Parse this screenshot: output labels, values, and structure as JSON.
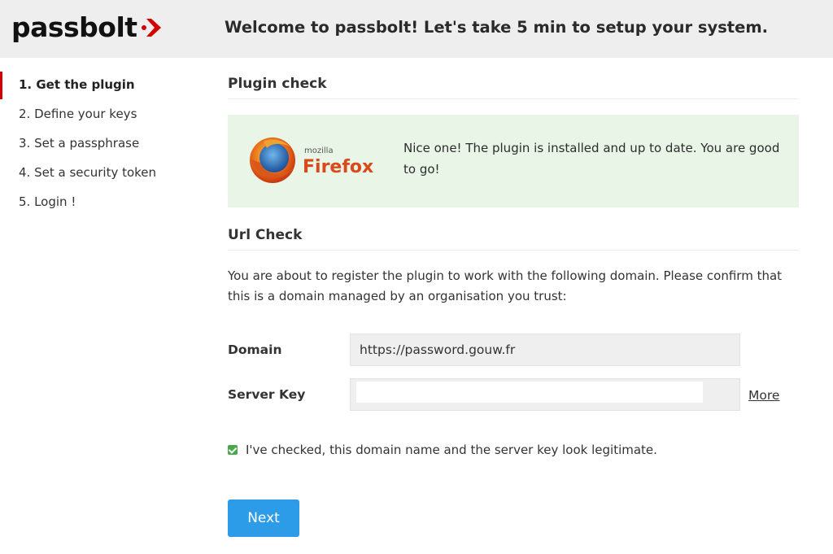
{
  "header": {
    "logo_text": "passbolt",
    "title": "Welcome to passbolt! Let's take 5 min to setup your system."
  },
  "sidebar": {
    "steps": [
      {
        "label": "1. Get the plugin",
        "active": true
      },
      {
        "label": "2. Define your keys",
        "active": false
      },
      {
        "label": "3. Set a passphrase",
        "active": false
      },
      {
        "label": "4. Set a security token",
        "active": false
      },
      {
        "label": "5. Login !",
        "active": false
      }
    ]
  },
  "plugin_check": {
    "title": "Plugin check",
    "browser_brand_small": "mozilla",
    "browser_brand": "Firefox",
    "message": "Nice one! The plugin is installed and up to date. You are good to go!"
  },
  "url_check": {
    "title": "Url Check",
    "intro": "You are about to register the plugin to work with the following domain. Please confirm that this is a domain managed by an organisation you trust:",
    "domain_label": "Domain",
    "domain_value": "https://password.gouw.fr",
    "server_key_label": "Server Key",
    "more_label": "More",
    "confirm_label": "I've checked, this domain name and the server key look legitimate.",
    "confirm_checked": true
  },
  "actions": {
    "next_label": "Next"
  },
  "colors": {
    "accent": "#2c9be8",
    "brand_red": "#d40101",
    "success_bg": "#e8f5e7",
    "checkbox": "#4ba84a"
  }
}
